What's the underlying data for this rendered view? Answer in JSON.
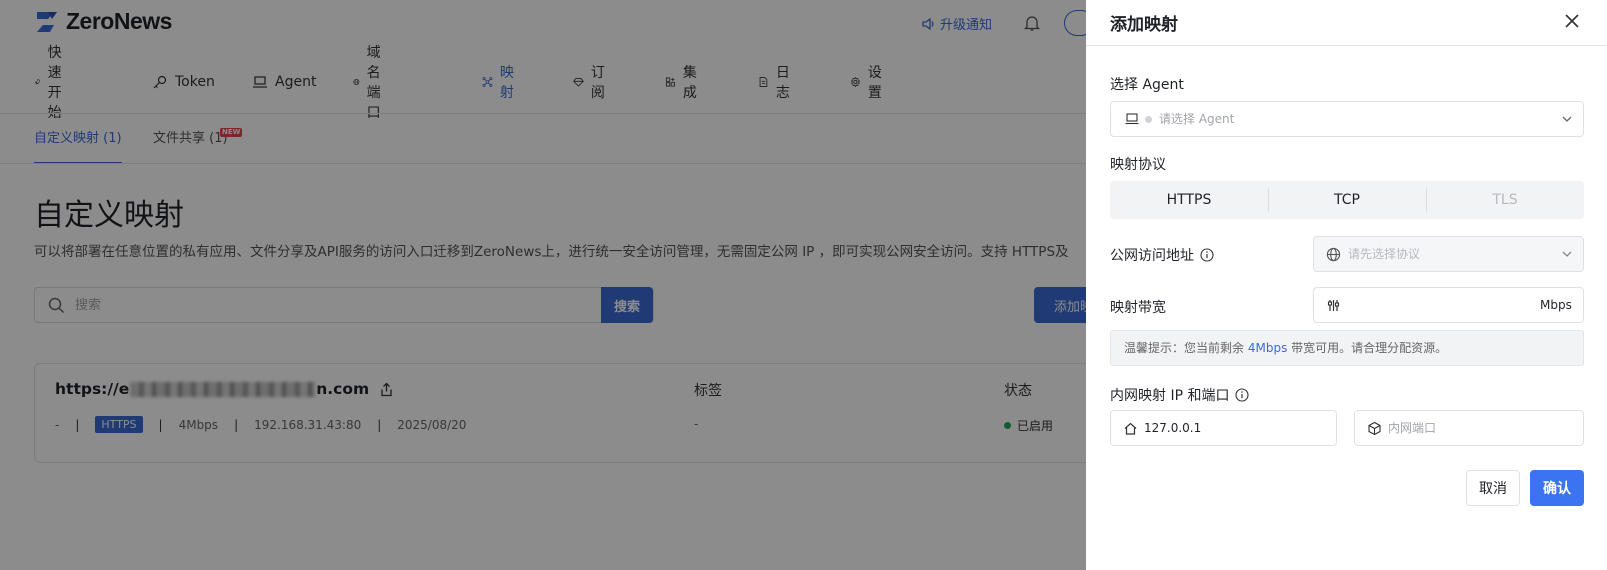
{
  "app": {
    "logo_text": "ZeroNews"
  },
  "topbar": {
    "upgrade_label": "升级通知"
  },
  "nav": {
    "items": [
      {
        "label": "快速开始",
        "icon": "rocket-icon"
      },
      {
        "label": "Token",
        "icon": "key-icon"
      },
      {
        "label": "Agent",
        "icon": "laptop-icon"
      },
      {
        "label": "域名端口",
        "icon": "globe-icon"
      },
      {
        "label": "映射",
        "icon": "mapping-icon",
        "active": true
      },
      {
        "label": "订阅",
        "icon": "diamond-icon"
      },
      {
        "label": "集成",
        "icon": "integration-icon"
      },
      {
        "label": "日志",
        "icon": "document-icon"
      },
      {
        "label": "设置",
        "icon": "gear-icon"
      }
    ]
  },
  "subtabs": {
    "custom": "自定义映射 (1)",
    "share": "文件共享 (1)",
    "new_badge": "NEW"
  },
  "main": {
    "title": "自定义映射",
    "description": "可以将部署在任意位置的私有应用、文件分享及API服务的访问入口迁移到ZeroNews上，进行统一安全访问管理，无需固定公网 IP ，即可实现公网安全访问。支持 HTTPS及",
    "search_placeholder": "搜索",
    "search_button": "搜索",
    "add_button": "添加映射"
  },
  "card": {
    "url_prefix": "https://e",
    "url_suffix": "n.com",
    "dash": "-",
    "protocol": "HTTPS",
    "bandwidth": "4Mbps",
    "address": "192.168.31.43:80",
    "date": "2025/08/20",
    "tag_header": "标签",
    "tag_value": "-",
    "status_header": "状态",
    "status_value": "已启用"
  },
  "drawer": {
    "title": "添加映射",
    "agent_label": "选择 Agent",
    "agent_placeholder": "请选择 Agent",
    "protocol_label": "映射协议",
    "protocols": [
      "HTTPS",
      "TCP",
      "TLS"
    ],
    "public_label": "公网访问地址",
    "public_placeholder": "请先选择协议",
    "bandwidth_label": "映射带宽",
    "bandwidth_unit": "Mbps",
    "tip_prefix": "温馨提示：您当前剩余",
    "tip_value": "4Mbps",
    "tip_suffix": "带宽可用。请合理分配资源。",
    "intranet_label": "内网映射 IP 和端口",
    "ip_value": "127.0.0.1",
    "port_placeholder": "内网端口",
    "cancel": "取消",
    "confirm": "确认"
  },
  "colors": {
    "accent": "#3b6bd6",
    "confirm": "#3b74f0",
    "status_green": "#22a55a",
    "new_badge": "#e5484d"
  }
}
